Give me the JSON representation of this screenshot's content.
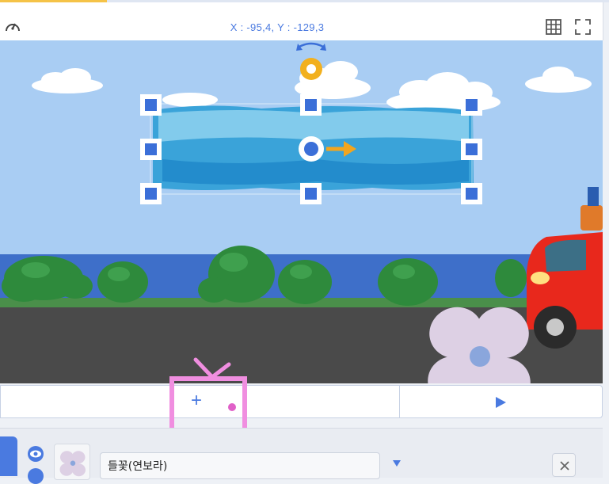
{
  "toolbar": {
    "coordinates": "X : -95,4, Y : -129,3",
    "icons": [
      "speedometer-icon",
      "grid-icon",
      "fullscreen-icon"
    ]
  },
  "controls": {
    "add_label": "+",
    "icons": [
      "play-icon"
    ]
  },
  "sprite_panel": {
    "sprite_name": "들꽃(연보라)",
    "icons": [
      "eye-icon",
      "link-icon",
      "dropdown-arrow-icon",
      "close-icon"
    ]
  },
  "colors": {
    "accent_blue": "#4a7ae0",
    "sky": "#a9cdf3",
    "sea": "#3e6fc9",
    "road": "#4a4a4a",
    "brush_stroke": "#3aa3d9",
    "rotation_handle": "#f2b01e",
    "direction_arrow": "#f2a51e",
    "flower_petal": "#ddd0e4",
    "flower_center": "#8aa6dc",
    "car_body": "#e8281c",
    "annotation_pink": "#f08ee0"
  }
}
